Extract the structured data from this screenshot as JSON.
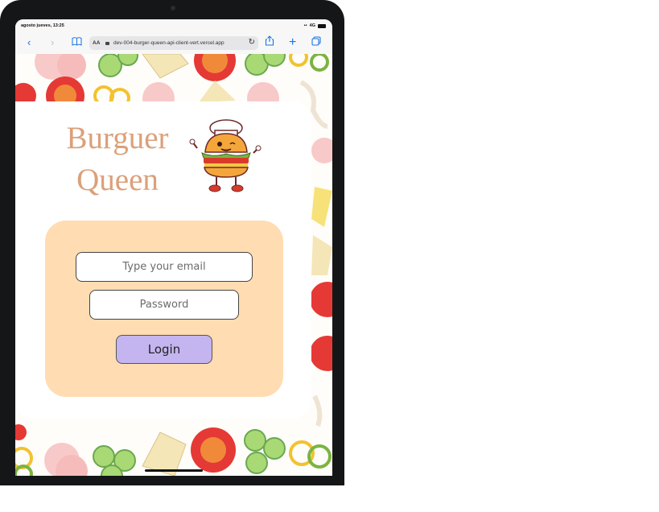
{
  "status": {
    "time": "agosto jueves, 13:25",
    "signal": "4G"
  },
  "browser": {
    "text_size": "AA",
    "url": "dev-004-burger-queen-api-client-vert.vercel.app"
  },
  "app": {
    "title_line1": "Burguer",
    "title_line2": "Queen",
    "email_placeholder": "Type your email",
    "password_placeholder": "Password",
    "login_label": "Login"
  },
  "colors": {
    "title": "#dba07a",
    "form_bg": "#ffdcb2",
    "login_bg": "#c4b5f0"
  }
}
